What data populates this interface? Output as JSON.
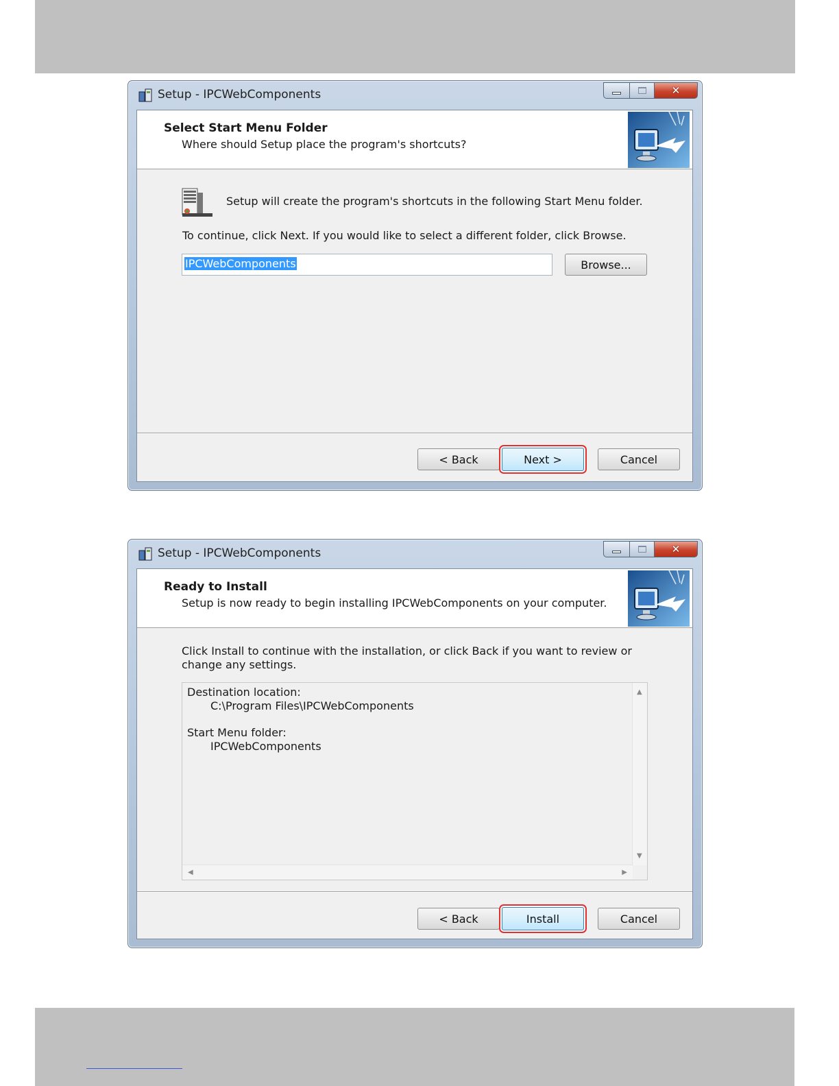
{
  "dialog1": {
    "title": "Setup - IPCWebComponents",
    "header_title": "Select Start Menu Folder",
    "header_subtitle": "Where should Setup place the program's shortcuts?",
    "info_text": "Setup will create the program's shortcuts in the following Start Menu folder.",
    "instruction": "To continue, click Next. If you would like to select a different folder, click Browse.",
    "folder_value": "IPCWebComponents",
    "browse_label": "Browse...",
    "back_label": "< Back",
    "next_label": "Next >",
    "cancel_label": "Cancel"
  },
  "dialog2": {
    "title": "Setup - IPCWebComponents",
    "header_title": "Ready to Install",
    "header_subtitle": "Setup is now ready to begin installing IPCWebComponents on your computer.",
    "instruction_line1": "Click Install to continue with the installation, or click Back if you want to review or",
    "instruction_line2": "change any settings.",
    "memo": {
      "dest_label": "Destination location:",
      "dest_value": "C:\\Program Files\\IPCWebComponents",
      "menu_label": "Start Menu folder:",
      "menu_value": "IPCWebComponents"
    },
    "back_label": "< Back",
    "install_label": "Install",
    "cancel_label": "Cancel"
  },
  "icons": {
    "app": "setup-app-icon",
    "header": "computer-monitor-icon",
    "folder": "start-menu-folder-icon"
  },
  "colors": {
    "highlight_border": "#e03030",
    "selection": "#3399ff",
    "page_band": "#c0c0c0"
  }
}
